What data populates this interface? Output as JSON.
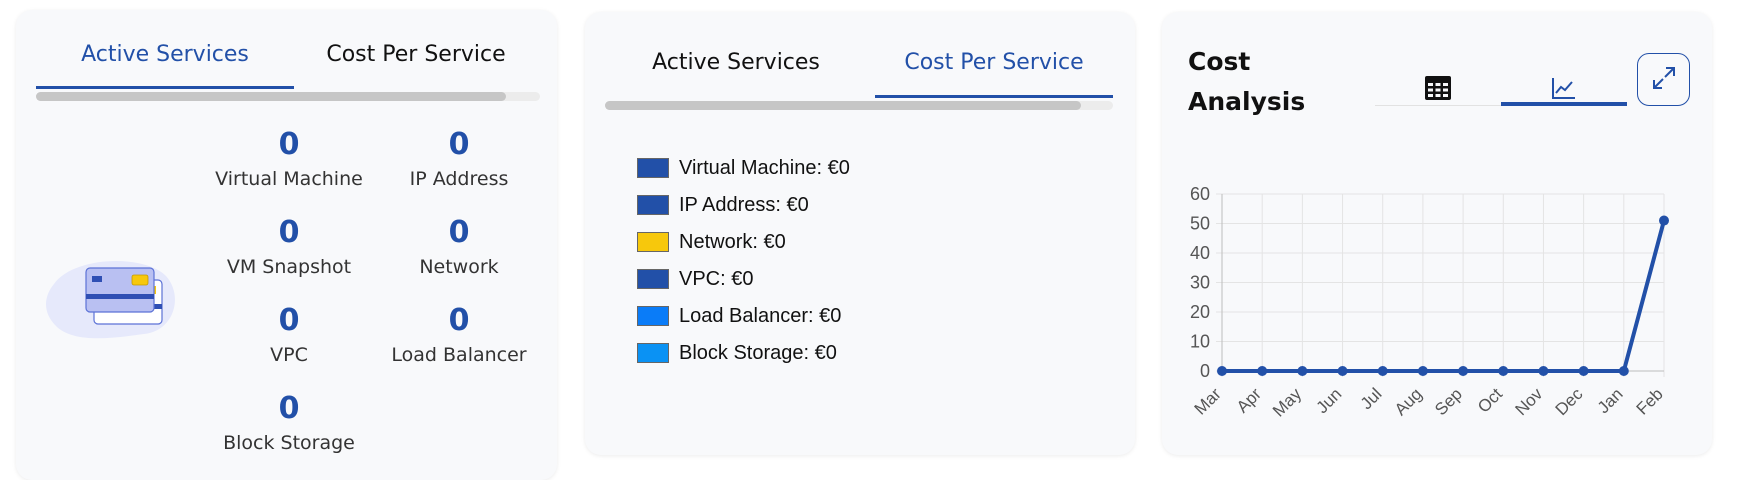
{
  "panel_services": {
    "tabs": [
      {
        "label": "Active Services",
        "active": true
      },
      {
        "label": "Cost Per Service",
        "active": false
      }
    ],
    "services": [
      {
        "name": "Virtual Machine",
        "count": "0"
      },
      {
        "name": "IP Address",
        "count": "0"
      },
      {
        "name": "VM Snapshot",
        "count": "0"
      },
      {
        "name": "Network",
        "count": "0"
      },
      {
        "name": "VPC",
        "count": "0"
      },
      {
        "name": "Load Balancer",
        "count": "0"
      },
      {
        "name": "Block Storage",
        "count": "0"
      }
    ],
    "illustration_icon": "credit-cards-icon"
  },
  "panel_costs": {
    "tabs": [
      {
        "label": "Active Services",
        "active": false
      },
      {
        "label": "Cost Per Service",
        "active": true
      }
    ],
    "legend": [
      {
        "label": "Virtual Machine: €0",
        "color": "#2250a8"
      },
      {
        "label": "IP Address: €0",
        "color": "#2250a8"
      },
      {
        "label": "Network: €0",
        "color": "#f7c80c"
      },
      {
        "label": "VPC: €0",
        "color": "#2250a8"
      },
      {
        "label": "Load Balancer: €0",
        "color": "#0a7cf8"
      },
      {
        "label": "Block Storage: €0",
        "color": "#0a92f4"
      }
    ]
  },
  "panel_analysis": {
    "title_line1": "Cost",
    "title_line2": "Analysis",
    "view_tabs": [
      {
        "icon": "table-icon",
        "active": false
      },
      {
        "icon": "line-chart-icon",
        "active": true
      }
    ],
    "expand_icon": "expand-icon",
    "accent_color": "#2250a8"
  },
  "chart_data": {
    "type": "line",
    "categories": [
      "Mar",
      "Apr",
      "May",
      "Jun",
      "Jul",
      "Aug",
      "Sep",
      "Oct",
      "Nov",
      "Dec",
      "Jan",
      "Feb"
    ],
    "series": [
      {
        "values": [
          0,
          0,
          0,
          0,
          0,
          0,
          0,
          0,
          0,
          0,
          0,
          51
        ]
      }
    ],
    "ylim": [
      0,
      60
    ],
    "yticks": [
      "0",
      "10",
      "20",
      "30",
      "40",
      "50",
      "60"
    ],
    "grid": true,
    "title": "",
    "xlabel": "",
    "ylabel": ""
  }
}
